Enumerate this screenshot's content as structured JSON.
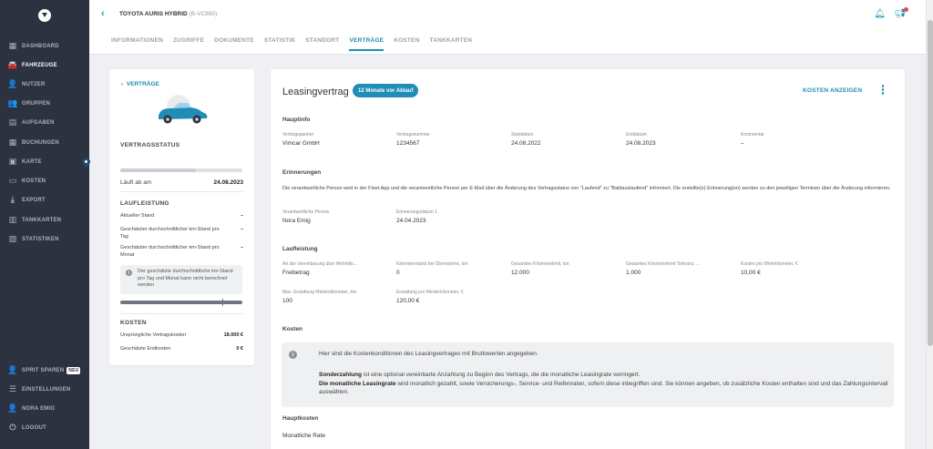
{
  "sidebar": {
    "items": [
      {
        "label": "DASHBOARD",
        "icon": "dashboard-icon",
        "glyph": "▦"
      },
      {
        "label": "FAHRZEUGE",
        "icon": "car-icon",
        "glyph": "🚘"
      },
      {
        "label": "NUTZER",
        "icon": "user-icon",
        "glyph": "👤"
      },
      {
        "label": "GRUPPEN",
        "icon": "group-icon",
        "glyph": "👥"
      },
      {
        "label": "AUFGABEN",
        "icon": "clipboard-icon",
        "glyph": "▤"
      },
      {
        "label": "BUCHUNGEN",
        "icon": "calendar-icon",
        "glyph": "▦"
      },
      {
        "label": "KARTE",
        "icon": "map-icon",
        "glyph": "▣"
      },
      {
        "label": "KOSTEN",
        "icon": "wallet-icon",
        "glyph": "▭"
      },
      {
        "label": "EXPORT",
        "icon": "download-icon",
        "glyph": "⤓"
      },
      {
        "label": "TANKKARTEN",
        "icon": "fuel-card-icon",
        "glyph": "▥"
      },
      {
        "label": "STATISTIKEN",
        "icon": "chart-icon",
        "glyph": "▧"
      }
    ],
    "bottom_items": [
      {
        "label": "SPRIT SPAREN",
        "icon": "savings-icon",
        "glyph": "👤",
        "badge": "NEU"
      },
      {
        "label": "EINSTELLUNGEN",
        "icon": "settings-icon",
        "glyph": "☰"
      },
      {
        "label": "NORA EMIG",
        "icon": "user-icon",
        "glyph": "👤"
      },
      {
        "label": "LOGOUT",
        "icon": "power-icon",
        "glyph": "⏻"
      }
    ]
  },
  "header": {
    "vehicle": "TOYOTA AURIS HYBRID",
    "plate": "(B-VC890)",
    "tabs": [
      "INFORMATIONEN",
      "ZUGRIFFE",
      "DOKUMENTE",
      "STATISTIK",
      "STANDORT",
      "VERTRÄGE",
      "KOSTEN",
      "TANKKARTEN"
    ],
    "active_tab": "VERTRÄGE"
  },
  "left": {
    "back_label": "VERTRÄGE",
    "status_heading": "VERTRAGSSTATUS",
    "status_progress": 0.62,
    "laeuft_label": "Läuft ab am",
    "laeuft_value": "24.08.2023",
    "laufleistung_heading": "LAUFLEISTUNG",
    "rows": [
      {
        "label": "Aktueller Stand",
        "value": "–"
      },
      {
        "label": "Geschätzter durchschnittlicher km-Stand pro Tag",
        "value": "–"
      },
      {
        "label": "Geschätzter durchschnittlicher km-Stand pro Monat",
        "value": "–"
      }
    ],
    "info_text": "Der geschätzte durchschnittliche km-Stand pro Tag und Monat kann nicht berechnet werden",
    "kosten_heading": "KOSTEN",
    "kosten_rows": [
      {
        "label": "Ursprüngliche Vertragskosten",
        "value": "18.000 €"
      },
      {
        "label": "Geschätzte Endkosten",
        "value": "0 €"
      }
    ]
  },
  "main": {
    "title": "Leasingvertrag",
    "pill": "12 Monate vor Ablauf",
    "kosten_button": "KOSTEN ANZEIGEN",
    "hauptinfo": {
      "heading": "Hauptinfo",
      "fields": [
        {
          "label": "Vertragspartner",
          "value": "Vimcar GmbH"
        },
        {
          "label": "Vertragsnummer",
          "value": "1234567"
        },
        {
          "label": "Startdatum",
          "value": "24.08.2022"
        },
        {
          "label": "Enddatum",
          "value": "24.08.2023"
        },
        {
          "label": "Kommentar",
          "value": "–"
        }
      ]
    },
    "erinnerungen": {
      "heading": "Erinnerungen",
      "text": "Die verantwortliche Person wird in der Fleet App und die verantwortliche Person per E-Mail über die Änderung des Vertragsstatus von \"Laufend\" zu \"Baldauslaufend\" informiert. Die erstellte(n) Erinnerung(en) werden zu den jeweiligen Terminen über die Änderung informieren.",
      "fields": [
        {
          "label": "Verantwortliche Person",
          "value": "Nora Emig"
        },
        {
          "label": "Erinnerungsdatum 1",
          "value": "24.04.2023"
        }
      ]
    },
    "laufleistung": {
      "heading": "Laufleistung",
      "fields": [
        {
          "label": "Art der Vereinbarung über Mehrkilo...",
          "value": "Freibetrag"
        },
        {
          "label": "Kilometerstand bei Übernahme, km",
          "value": "0"
        },
        {
          "label": "Gesamtes Kilometerlimit, km",
          "value": "12.000"
        },
        {
          "label": "Gesamtes Kilometerlimit Toleranz, ...",
          "value": "1.000"
        },
        {
          "label": "Kosten pro Mehrkilometer, €",
          "value": "10,00 €"
        },
        {
          "label": "Max. Erstattung Minderkilometer, km",
          "value": "100"
        },
        {
          "label": "Erstattung pro Minderkilometer, €",
          "value": "120,00 €"
        }
      ]
    },
    "kosten": {
      "heading": "Kosten",
      "info_line": "Hier sind die Kostenkonditionen des Leasingvertrages mit Bruttowerten angegeben.",
      "sonder_bold": "Sonderzahlung",
      "sonder_text": " ist eine optional vereinbarte Anzahlung zu Beginn des Vertrags, die die monatliche Leasingrate verringert.",
      "rate_bold": "Die monatliche Leasingrate",
      "rate_text": " wird monatlich gezahlt, sowie Versicherungs-, Service- und Reifenraten, sofern diese inbegriffen sind. Sie können angeben, ob zusätzliche Kosten enthalten sind und das Zahlungsintervall auswählen."
    },
    "hauptkosten": {
      "heading": "Hauptkosten",
      "first_label": "Monatliche Rate"
    }
  }
}
